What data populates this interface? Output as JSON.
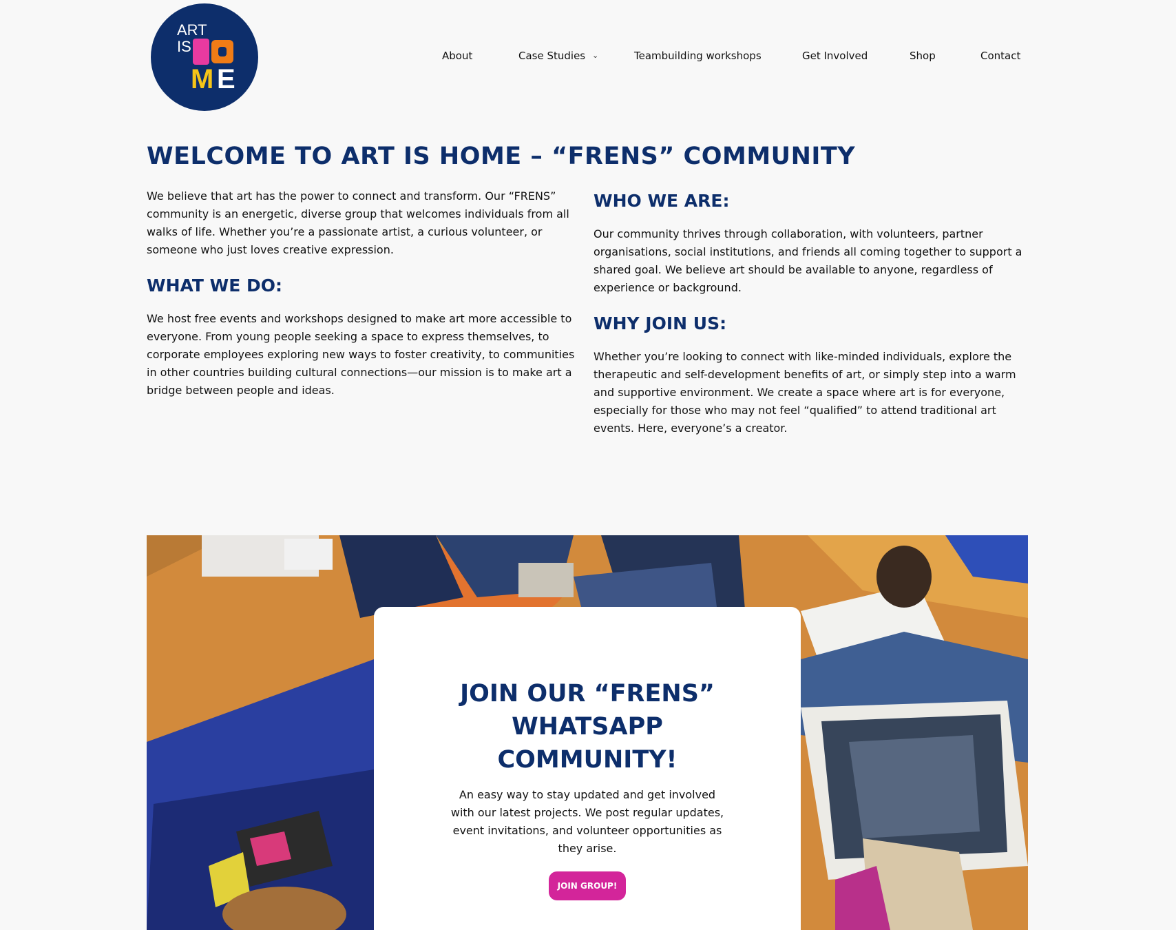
{
  "logo": {
    "line1": "ART",
    "line2": "IS",
    "line3a": "M",
    "line3b": "E"
  },
  "nav": {
    "items": [
      {
        "label": "About"
      },
      {
        "label": "Case Studies"
      },
      {
        "label": "Teambuilding workshops"
      },
      {
        "label": "Get Involved"
      },
      {
        "label": "Shop"
      },
      {
        "label": "Contact"
      }
    ],
    "case_studies_chevron": "⌄"
  },
  "main": {
    "title": "WELCOME TO ART IS HOME – “FRENS” COMMUNITY",
    "intro": "We believe that art has the power to connect and transform. Our “FRENS” community is an energetic, diverse group that welcomes individuals from all walks of life. Whether you’re a passionate artist, a curious volunteer, or someone who just loves creative expression.",
    "what_we_do": {
      "heading": "WHAT WE DO:",
      "text": "We host free events and workshops designed to make art more accessible to everyone. From young people seeking a space to express themselves, to corporate employees exploring new ways to foster creativity, to communities in other countries building cultural connections—our mission is to make art a bridge between people and ideas."
    },
    "who_we_are": {
      "heading": "WHO WE ARE:",
      "text": "Our community thrives through collaboration, with volunteers, partner organisations, social institutions, and friends all coming together to support a shared goal. We believe art should be available to anyone, regardless of experience or background."
    },
    "why_join": {
      "heading": "WHY JOIN US:",
      "text": "Whether you’re looking to connect with like-minded individuals, explore the therapeutic and self-development benefits of art, or simply step into a warm and supportive environment. We create a space where art is for everyone, especially for those who may not feel “qualified” to attend traditional art events. Here, everyone’s a creator."
    }
  },
  "whatsapp": {
    "title": "JOIN OUR “FRENS” WHATSAPP COMMUNITY!",
    "text": "An easy way to stay updated and get involved with our latest projects. We post regular updates, event invitations, and volunteer opportunities as they arise.",
    "button": "JOIN GROUP!"
  },
  "colors": {
    "brand_navy": "#0d2e6b",
    "button_pink": "#d3259a",
    "page_bg": "#f8f8f8"
  }
}
